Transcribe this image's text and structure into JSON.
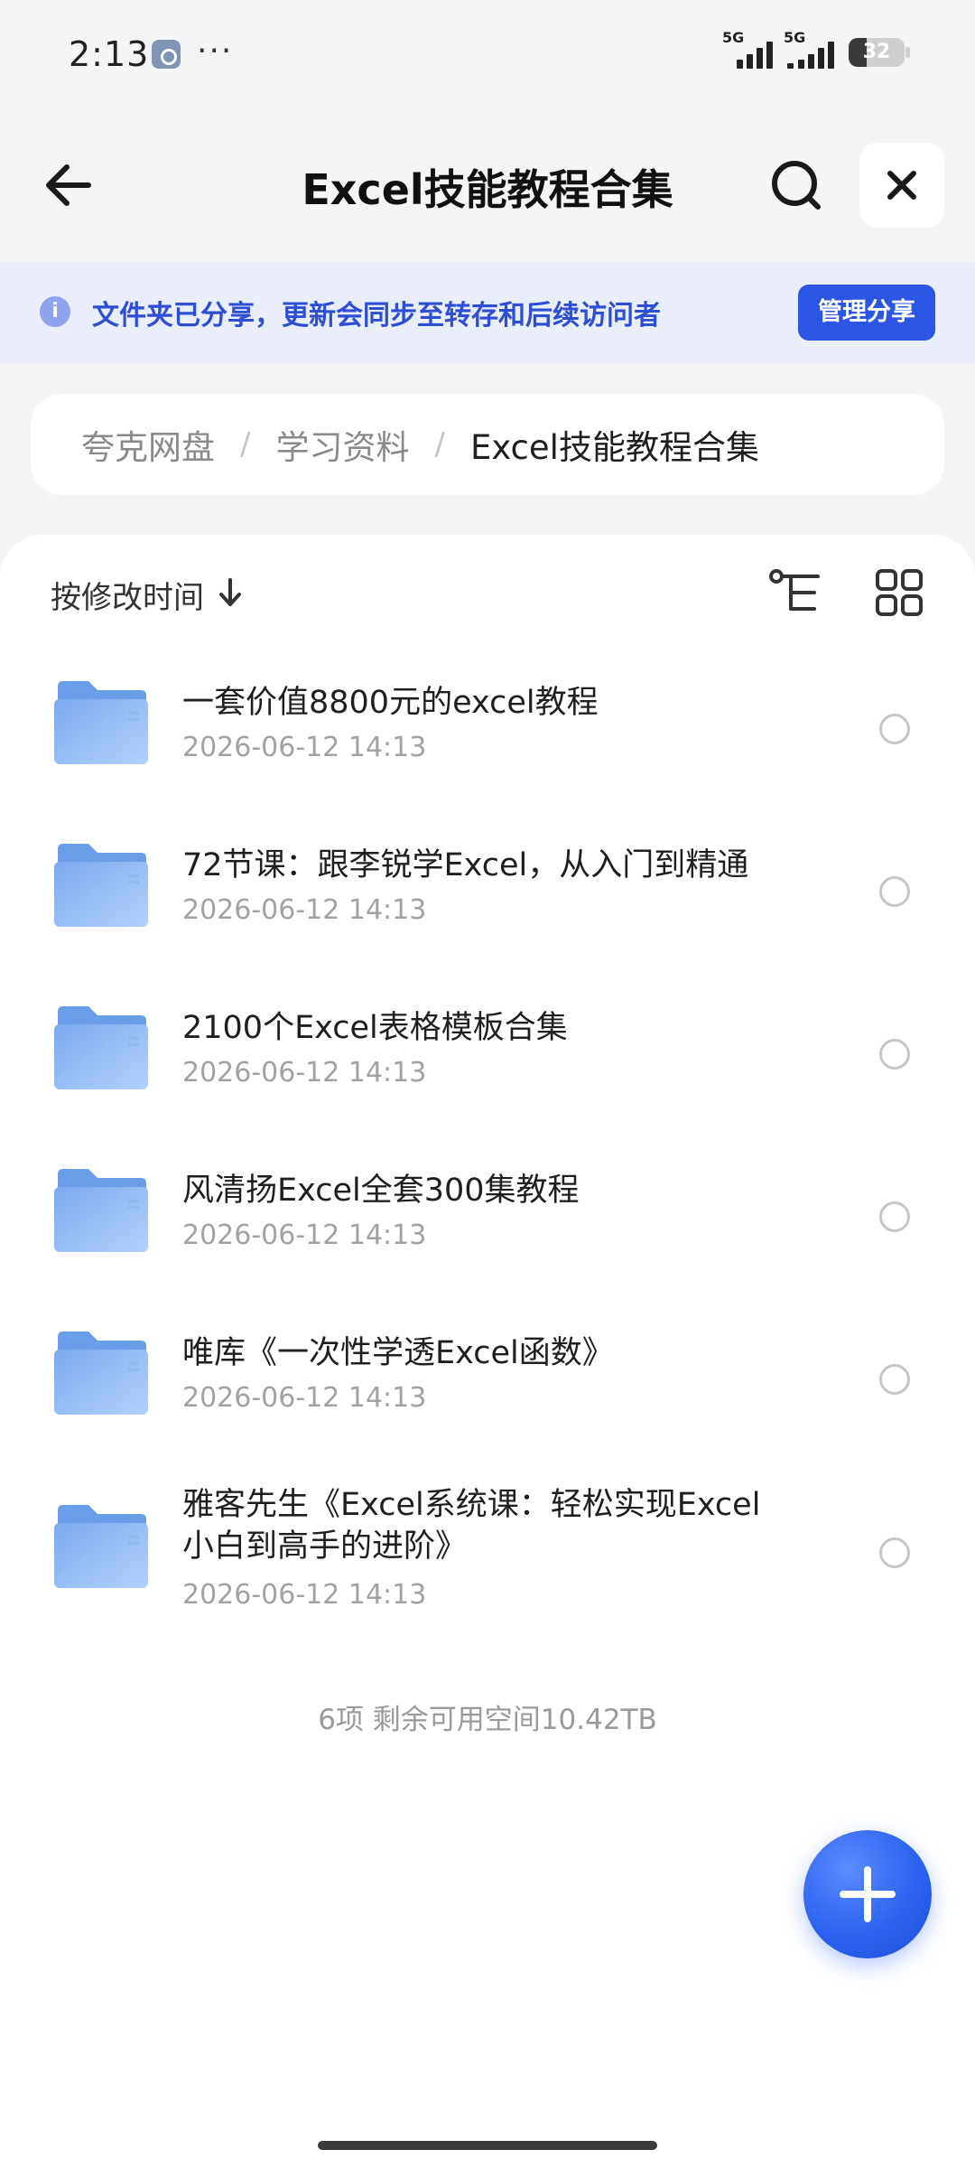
{
  "status_bar": {
    "time": "2:13",
    "more": "···",
    "signal_1": "5G",
    "signal_2": "5G",
    "battery_level": "32",
    "battery_fraction": 0.32
  },
  "header": {
    "title": "Excel技能教程合集",
    "icons": [
      "arrow-left-icon",
      "search-icon",
      "close-icon"
    ]
  },
  "share_banner": {
    "text": "文件夹已分享，更新会同步至转存和后续访问者",
    "button": "管理分享",
    "icon": "info-icon"
  },
  "breadcrumb": {
    "items": [
      "夸克网盘",
      "学习资料",
      "Excel技能教程合集"
    ],
    "separator": "/"
  },
  "sort": {
    "label": "按修改时间",
    "icons": [
      "arrow-down-icon",
      "tree-view-icon",
      "grid-view-icon"
    ]
  },
  "files": [
    {
      "name": "一套价值8800元的excel教程",
      "date": "2026-06-12 14:13"
    },
    {
      "name": "72节课：跟李锐学Excel，从入门到精通",
      "date": "2026-06-12 14:13"
    },
    {
      "name": "2100个Excel表格模板合集",
      "date": "2026-06-12 14:13"
    },
    {
      "name": "风清扬Excel全套300集教程",
      "date": "2026-06-12 14:13"
    },
    {
      "name": "唯库《一次性学透Excel函数》",
      "date": "2026-06-12 14:13"
    },
    {
      "name": "雅客先生《Excel系统课：轻松实现Excel小白到高手的进阶》",
      "date": "2026-06-12 14:13"
    }
  ],
  "footer": {
    "summary": "6项 剩余可用空间10.42TB"
  },
  "fab": {
    "icon": "plus-icon"
  },
  "colors": {
    "accent": "#2a55e5",
    "banner_bg": "#eaedfa",
    "banner_text": "#2c4fd6",
    "folder": "#7fb0f2"
  }
}
